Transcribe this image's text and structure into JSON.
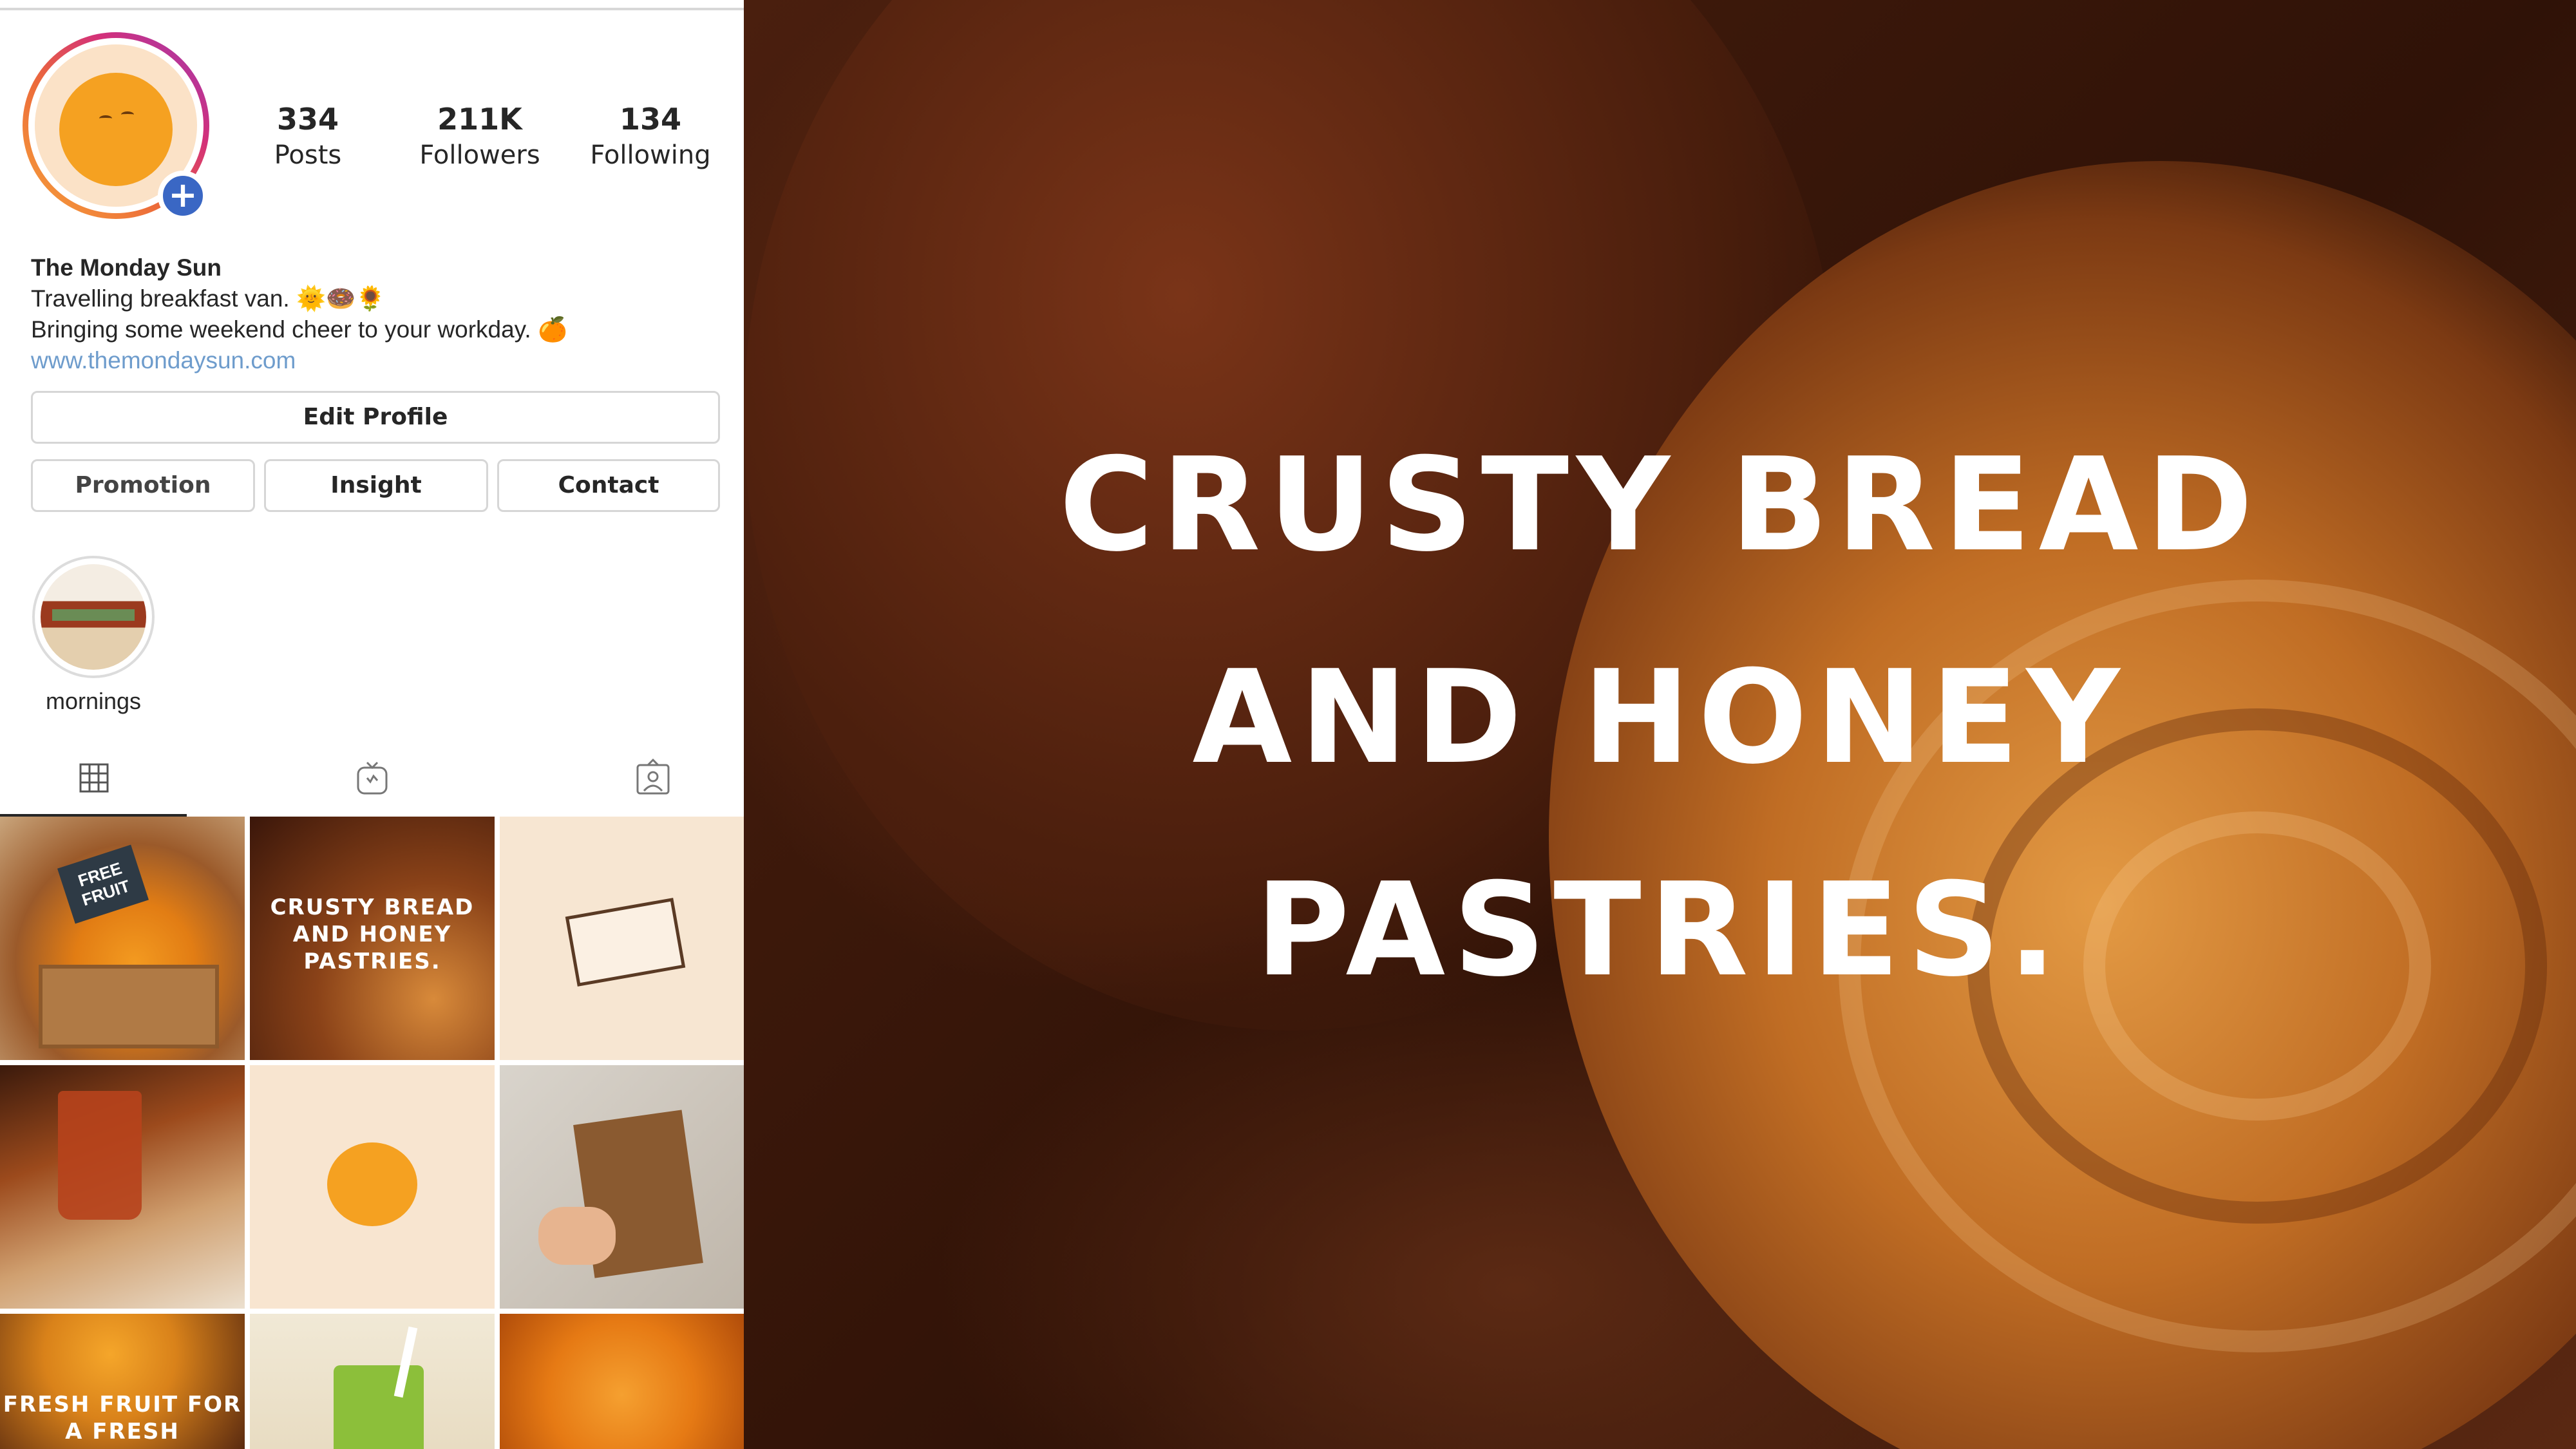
{
  "profile": {
    "stats": {
      "posts": {
        "value": "334",
        "label": "Posts"
      },
      "followers": {
        "value": "211K",
        "label": "Followers"
      },
      "following": {
        "value": "134",
        "label": "Following"
      }
    },
    "name": "The Monday Sun",
    "bio_line1": "Travelling breakfast van. 🌞🍩🌻",
    "bio_line2": "Bringing some weekend cheer to your workday. 🍊",
    "website": "www.themondaysun.com",
    "buttons": {
      "edit_profile": "Edit Profile",
      "promotion": "Promotion",
      "insight": "Insight",
      "contact": "Contact"
    },
    "highlights": [
      {
        "label": "mornings"
      }
    ],
    "tabs": [
      {
        "icon": "grid-icon",
        "active": true
      },
      {
        "icon": "igtv-icon",
        "active": false
      },
      {
        "icon": "tagged-icon",
        "active": false
      }
    ],
    "posts": [
      {
        "caption": "",
        "sign": "FREE FRUIT"
      },
      {
        "caption": "CRUSTY BREAD AND HONEY PASTRIES."
      },
      {
        "caption": ""
      },
      {
        "caption": ""
      },
      {
        "caption": ""
      },
      {
        "caption": ""
      },
      {
        "caption": "FRESH FRUIT FOR A FRESH"
      },
      {
        "caption": ""
      },
      {
        "caption": ""
      }
    ]
  },
  "hero": {
    "line1": "CRUSTY BREAD",
    "line2": "AND HONEY",
    "line3": "PASTRIES."
  },
  "colors": {
    "brand_orange": "#f5a121",
    "link_blue": "#6e9ccc",
    "add_badge_blue": "#3a67c4"
  }
}
